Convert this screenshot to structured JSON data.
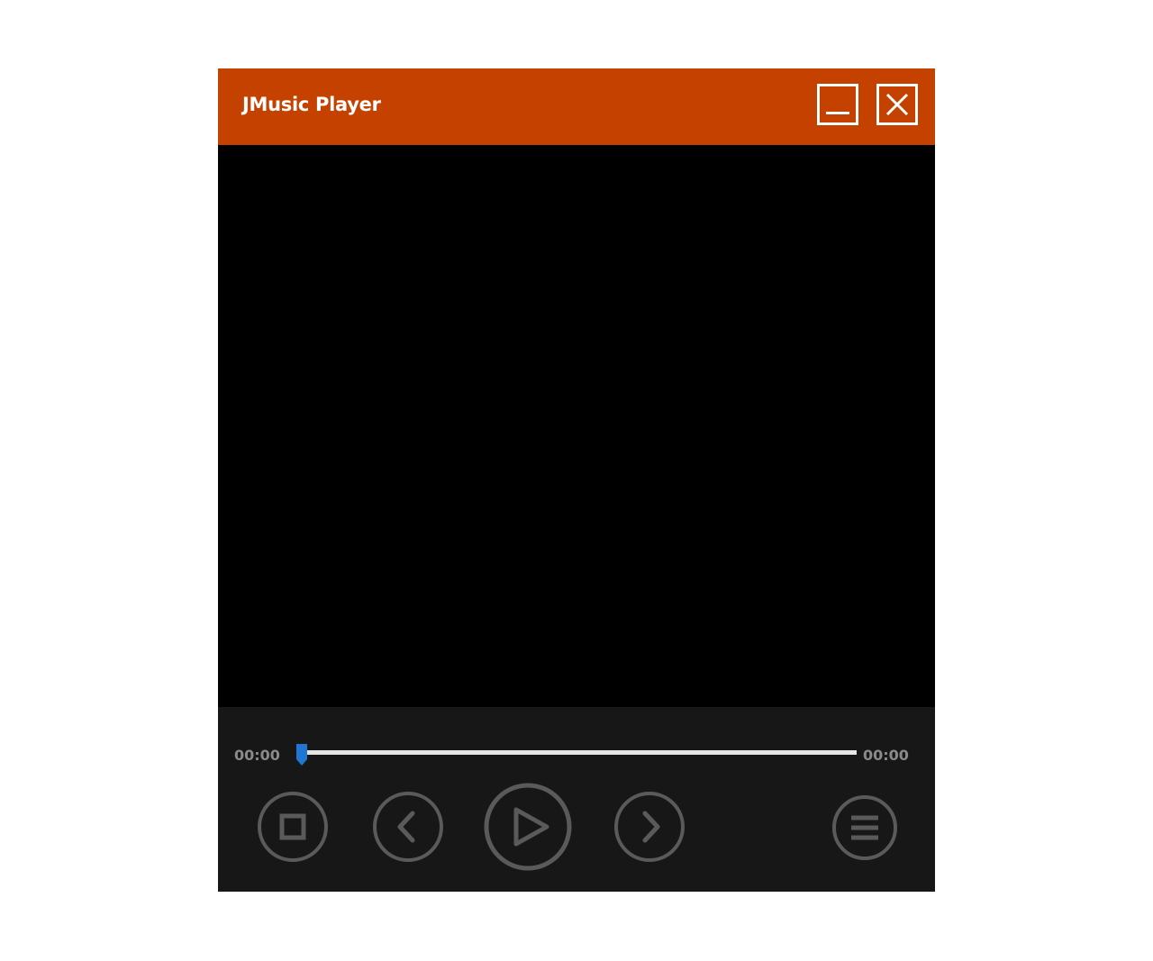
{
  "window": {
    "title": "JMusic Player",
    "minimize_icon": "minimize-icon",
    "close_icon": "close-icon"
  },
  "player": {
    "elapsed": "00:00",
    "total": "00:00",
    "progress": 0
  },
  "controls": [
    {
      "name": "stop-button",
      "icon": "stop-icon"
    },
    {
      "name": "previous-button",
      "icon": "chevron-left-icon"
    },
    {
      "name": "play-button",
      "icon": "play-icon"
    },
    {
      "name": "next-button",
      "icon": "chevron-right-icon"
    },
    {
      "name": "playlist-button",
      "icon": "menu-icon"
    }
  ],
  "colors": {
    "titlebar": "#c44100",
    "video_background": "#000000",
    "controls_background": "#171717",
    "icon": "#5a5a5a",
    "seek_thumb": "#1e78d2",
    "seek_track": "#e6e6e6",
    "time_text": "#8a8a8a"
  }
}
